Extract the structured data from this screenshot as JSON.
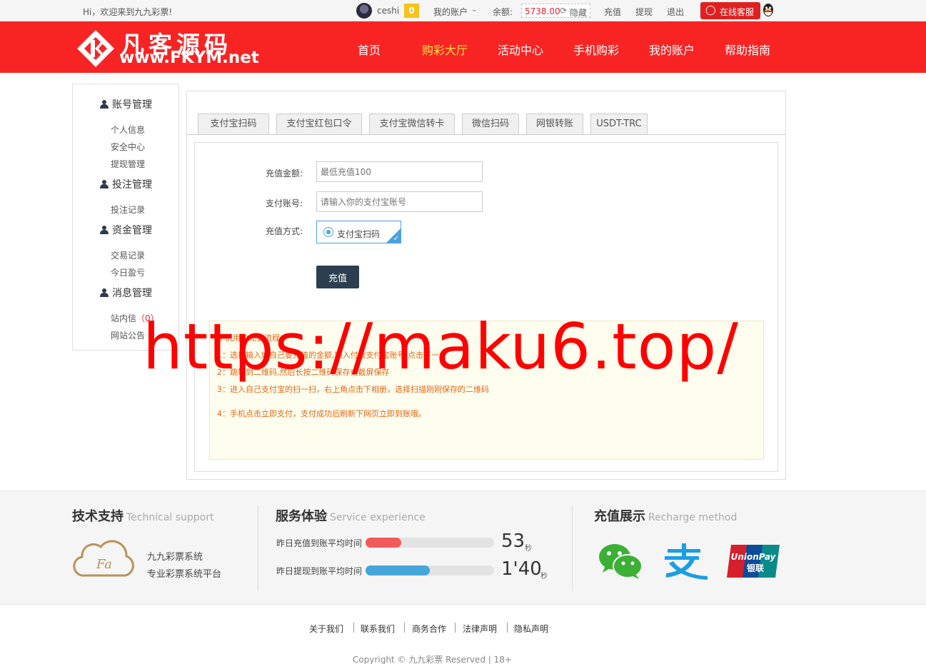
{
  "topbar": {
    "welcome": "Hi，欢迎来到九九彩票!",
    "username": "ceshi",
    "vip_level": "0",
    "my_account": "我的账户",
    "balance_label": "余额:",
    "balance_value": "5738.00",
    "hide_label": "隐藏",
    "recharge": "充值",
    "withdraw": "提现",
    "logout": "退出",
    "online_service": "在线客服"
  },
  "header": {
    "logo_name": "凡客源码",
    "logo_url": "www.FKYM.net",
    "nav": [
      "首页",
      "购彩大厅",
      "活动中心",
      "手机购彩",
      "我的账户",
      "帮助指南"
    ],
    "active_nav": "购彩大厅"
  },
  "sidebar": {
    "sections": [
      {
        "title": "账号管理",
        "items": [
          "个人信息",
          "安全中心",
          "提现管理"
        ]
      },
      {
        "title": "投注管理",
        "items": [
          "投注记录"
        ]
      },
      {
        "title": "资金管理",
        "items": [
          "交易记录",
          "今日盈亏"
        ]
      },
      {
        "title": "消息管理",
        "items": [
          "站内信",
          "网站公告"
        ]
      }
    ],
    "message_count": "（0）"
  },
  "tabs": [
    "支付宝扫码",
    "支付宝红包口令",
    "支付宝微信转卡",
    "微信扫码",
    "网银转账",
    "USDT-TRC"
  ],
  "form": {
    "amount_label": "充值金额:",
    "amount_placeholder": "最低充值100",
    "account_label": "支付账号:",
    "account_placeholder": "请输入你的支付宝账号",
    "method_label": "充值方式:",
    "method_option": "支付宝扫码",
    "submit": "充值"
  },
  "notice": {
    "title": "手机用户充值流程:",
    "lines": [
      "1：选择输入好自己要充值的金额,输入付款支付宝账号,点击下一步",
      "2：跳转到二维码,然后长按二维码保存或截屏保存",
      "3：进入自己支付宝的扫一扫，右上角点击下相册，选择扫描刚刚保存的二维码",
      "4：手机点击立即支付，支付成功后刷新下网页立即到账哦。"
    ]
  },
  "watermark": "https://maku6.top/",
  "footer": {
    "tech": {
      "title": "技术支持",
      "en": "Technical support",
      "line1": "九九彩票系统",
      "line2": "专业彩票系统平台",
      "cloud_text": "Fa"
    },
    "service": {
      "title": "服务体验",
      "en": "Service experience",
      "rows": [
        {
          "label": "昨日充值到账平均时间",
          "value": "53",
          "unit": "秒",
          "fill": 0.28,
          "color": "#f25a5a"
        },
        {
          "label": "昨日提现到账平均时间",
          "value": "1'40",
          "unit": "秒",
          "fill": 0.5,
          "color": "#45a6d9"
        }
      ]
    },
    "recharge": {
      "title": "充值展示",
      "en": "Recharge method",
      "icons": [
        "wechat-icon",
        "alipay-icon",
        "unionpay-icon"
      ],
      "unionpay_text": "UnionPay",
      "unionpay_cn": "银联"
    }
  },
  "bottom_links": [
    "关于我们",
    "联系我们",
    "商务合作",
    "法律声明",
    "隐私声明"
  ],
  "copyright": "Copyright © 九九彩票 Reserved | 18+",
  "colors": {
    "brand_red": "#f82424",
    "active_nav": "#ffe14d",
    "notice_text": "#e06a1a",
    "button_dark": "#2c3e50"
  }
}
